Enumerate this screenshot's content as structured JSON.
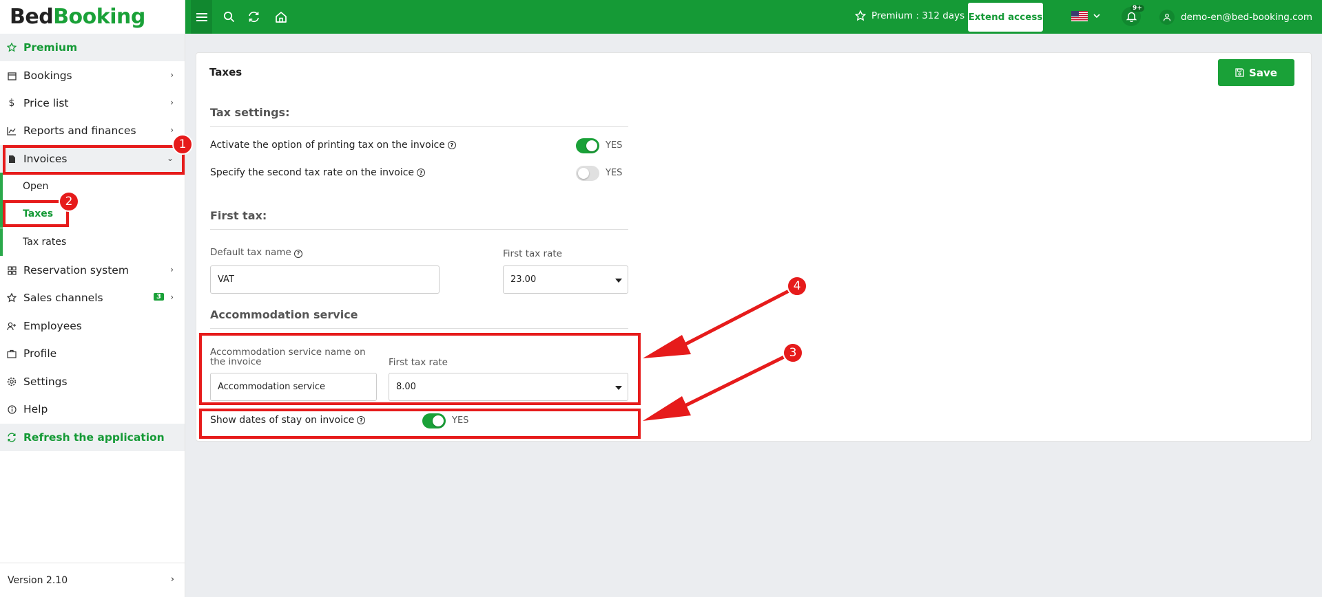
{
  "logo": {
    "part1": "Bed",
    "part2": "Booking"
  },
  "sidebar": {
    "premium": "Premium",
    "items": [
      {
        "label": "Bookings"
      },
      {
        "label": "Price list"
      },
      {
        "label": "Reports and finances"
      },
      {
        "label": "Invoices"
      },
      {
        "label": "Reservation system"
      },
      {
        "label": "Sales channels",
        "badge": "3"
      },
      {
        "label": "Employees"
      },
      {
        "label": "Profile"
      },
      {
        "label": "Settings"
      },
      {
        "label": "Help"
      }
    ],
    "invoice_sub": [
      {
        "label": "Open"
      },
      {
        "label": "Taxes"
      },
      {
        "label": "Tax rates"
      }
    ],
    "refresh": "Refresh the application",
    "version": "Version 2.10"
  },
  "topbar": {
    "premium_text": "Premium : 312 days",
    "extend_label": "Extend access",
    "notifications_badge": "9+",
    "user_email": "demo-en@bed-booking.com"
  },
  "page": {
    "title": "Taxes",
    "save_label": "Save",
    "tax_settings_heading": "Tax settings:",
    "print_tax_label": "Activate the option of printing tax on the invoice",
    "print_tax_value": "YES",
    "second_rate_label": "Specify the second tax rate on the invoice",
    "second_rate_value": "YES",
    "first_tax_heading": "First tax:",
    "default_tax_name_label": "Default tax name",
    "default_tax_name_value": "VAT",
    "first_tax_rate_label": "First tax rate",
    "first_tax_rate_value": "23.00",
    "accommodation_heading": "Accommodation service",
    "acc_name_label": "Accommodation service name on the invoice",
    "acc_name_value": "Accommodation service",
    "acc_rate_label": "First tax rate",
    "acc_rate_value": "8.00",
    "show_dates_label": "Show dates of stay on invoice",
    "show_dates_value": "YES"
  },
  "annotations": {
    "n1": "1",
    "n2": "2",
    "n3": "3",
    "n4": "4"
  },
  "colors": {
    "brand": "#1aa138",
    "annotation": "#e61b1b"
  }
}
